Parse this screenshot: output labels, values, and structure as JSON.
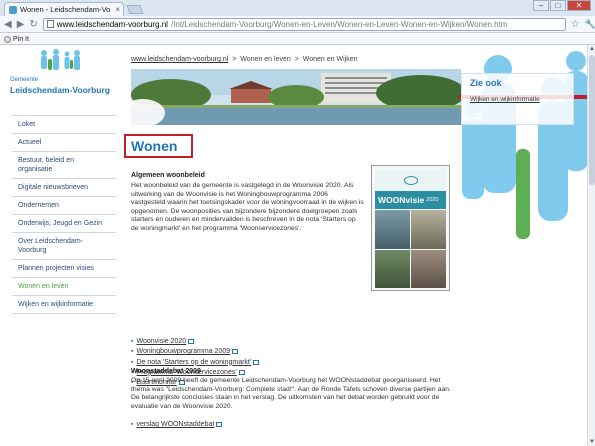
{
  "browser": {
    "tab_title": "Wonen - Leidschendam-Vo",
    "tab_close": "×",
    "window_buttons": {
      "minimize": "–",
      "maximize": "□",
      "close": "✕"
    },
    "nav": {
      "back": "◀",
      "forward": "▶",
      "reload": "↻",
      "star": "☆",
      "menu": "🔧"
    },
    "url_host": "www.leidschendam-voorburg.nl",
    "url_path": "/Int/Leidschendam-Voorburg/Wonen-en-Leven/Wonen-en-Leven-Wonen-en-Wijken/Wonen.htm",
    "bookmark": "Pin It"
  },
  "site": {
    "logo_small": "Gemeente",
    "logo_name": "Leidschendam-Voorburg",
    "breadcrumb": [
      "www.leidschendam-voorburg.nl",
      "Wonen en leven",
      "Wonen en Wijken"
    ],
    "breadcrumb_sep": ">"
  },
  "sidebar": {
    "items": [
      {
        "label": "Loket",
        "active": false
      },
      {
        "label": "Actueel",
        "active": false
      },
      {
        "label": "Bestuur, beleid en organisatie",
        "active": false
      },
      {
        "label": "Digitale nieuwsbrieven",
        "active": false
      },
      {
        "label": "Ondernemen",
        "active": false
      },
      {
        "label": "Onderwijs, Jeugd en Gezin",
        "active": false
      },
      {
        "label": "Over Leidschendam-Voorburg",
        "active": false
      },
      {
        "label": "Plannen projecten visies",
        "active": false
      },
      {
        "label": "Wonen en leven",
        "active": true
      },
      {
        "label": "Wijken en wijkinformatie",
        "active": false
      }
    ]
  },
  "zie_ook": {
    "title": "Zie ook",
    "link": "Wijken en wijkinformatie"
  },
  "main": {
    "title": "Wonen",
    "section1_title": "Algemeen woonbeleid",
    "section1_text": "Het woonbeleid van de gemeente is vastgelegd in de Woonvisie 2020. Als uitwerking van de Woonvisie is het Woningbouwprogramma 2006 vastgesteld waarin het toetsingskader voor de woningvoorraad in de wijken is opgenomen. De woonposities van bijzondere bijzondere doelgroepen zoals starters en ouderen en mindervaliden is beschreven in de nota 'Starters op de woningmarkt' en het programma 'Woonservicezones'.",
    "cover_title": "WOONvisie",
    "cover_year": "2020",
    "bullet": "▪",
    "links": [
      "Woonvisie 2020",
      "Woningbouwprogramma 2009",
      "De nota 'Starters op de woningmarkt'",
      "Programma 'Woonservicezones'",
      "Buurtmonitor"
    ],
    "section2_title": "Woonstaddebat 2009",
    "section2_text": "Op 15 april 2009 heeft de gemeente Leidschendam-Voorburg het WOONstaddebat georganiseerd. Het thema was \"Leidschendam-Voorburg: Complete stad!\". Aan de Ronde Tafels schoven diverse partijen aan. De belangrijkste conclusies staan in het verslag. De uitkomsten van het debat worden gebruikt voor de evaluatie van de Woonvisie 2020.",
    "bottom_link": "verslag WOONstaddebat"
  },
  "colors": {
    "brand_blue": "#1f76b3",
    "active_green": "#4aa63f",
    "highlight_red": "#c0202a",
    "figure_blue": "#6bc3ea"
  }
}
